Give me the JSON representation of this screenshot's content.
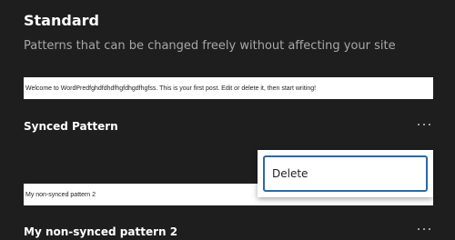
{
  "section": {
    "title": "Standard",
    "description": "Patterns that can be changed freely without affecting your site"
  },
  "patterns": [
    {
      "preview_text": "Welcome to WordPredfghdfdhdfhgfdhgdfhgfss. This is your first post. Edit or delete it, then start writing!",
      "title": "Synced Pattern"
    },
    {
      "preview_text": "My non-synced pattern 2",
      "title": "My non-synced pattern 2"
    }
  ],
  "dropdown": {
    "items": [
      {
        "label": "Delete"
      }
    ]
  },
  "icons": {
    "actions": "more-vertical-icon"
  },
  "colors": {
    "background": "#1e1e1e",
    "text_primary": "#ffffff",
    "text_muted": "#a7a7a7",
    "focus_border": "#2a6aa6"
  }
}
